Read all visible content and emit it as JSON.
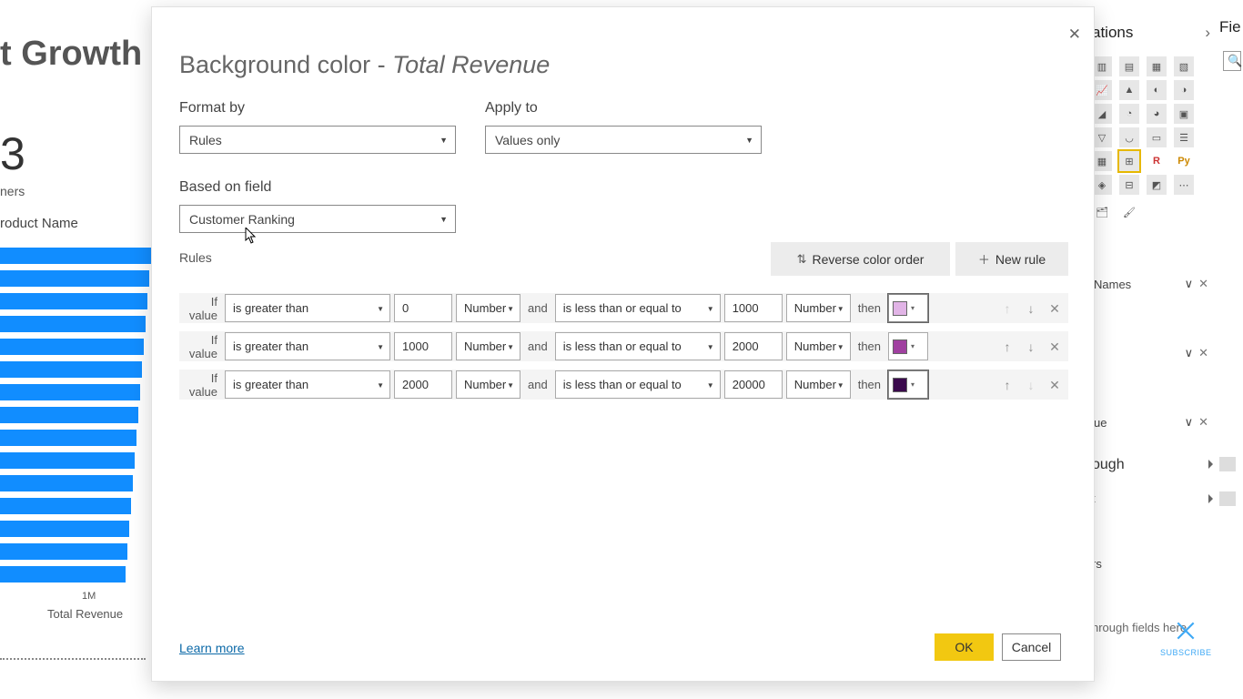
{
  "background": {
    "title_fragment": "t Growth",
    "big_number": "3",
    "sub_text": "ners",
    "column_header": "roduct Name",
    "axis_tick": "1M",
    "axis_title": "Total Revenue"
  },
  "right_panel": {
    "heading1": "ations",
    "heading2": "Fie",
    "search_glyph": "🔍",
    "field_names": "Names",
    "field_ue": "ue",
    "section_ough": "ough",
    "item_t": "t",
    "item_rs": "rs",
    "dt_text": "nrough fields here",
    "R": "R",
    "Py": "Py",
    "dots": "⋯",
    "subscribe": "SUBSCRIBE"
  },
  "dialog": {
    "title_prefix": "Background color - ",
    "title_field": "Total Revenue",
    "format_by_label": "Format by",
    "format_by_value": "Rules",
    "apply_to_label": "Apply to",
    "apply_to_value": "Values only",
    "based_on_label": "Based on field",
    "based_on_value": "Customer Ranking",
    "rules_label": "Rules",
    "reverse_btn": "Reverse color order",
    "new_rule_btn": "New rule",
    "if_value": "If value",
    "and": "and",
    "then": "then",
    "learn_more": "Learn more",
    "ok": "OK",
    "cancel": "Cancel",
    "rules": [
      {
        "op1": "is greater than",
        "v1": "0",
        "type1": "Number",
        "op2": "is less than or equal to",
        "v2": "1000",
        "type2": "Number",
        "color": "#E1B4E6"
      },
      {
        "op1": "is greater than",
        "v1": "1000",
        "type1": "Number",
        "op2": "is less than or equal to",
        "v2": "2000",
        "type2": "Number",
        "color": "#A040A0"
      },
      {
        "op1": "is greater than",
        "v1": "2000",
        "type1": "Number",
        "op2": "is less than or equal to",
        "v2": "20000",
        "type2": "Number",
        "color": "#3B0A4D"
      }
    ]
  }
}
